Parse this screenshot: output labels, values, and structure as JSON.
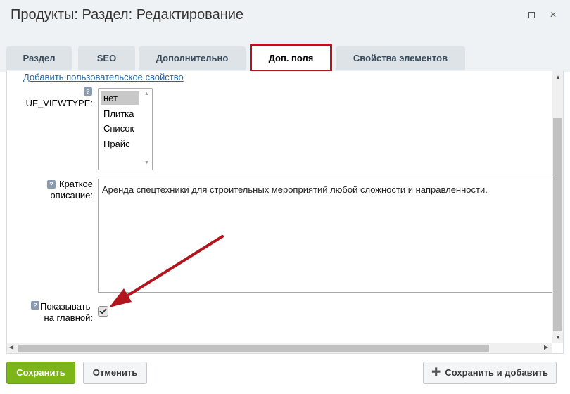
{
  "window": {
    "title": "Продукты: Раздел: Редактирование",
    "maximize_icon": "maximize-icon",
    "close_icon": "close-icon",
    "close_glyph": "×"
  },
  "tabs": [
    {
      "label": "Раздел",
      "active": false
    },
    {
      "label": "SEO",
      "active": false
    },
    {
      "label": "Дополнительно",
      "active": false
    },
    {
      "label": "Доп. поля",
      "active": true
    },
    {
      "label": "Свойства элементов",
      "active": false
    }
  ],
  "form": {
    "add_property_link": "Добавить пользовательское свойство",
    "help_glyph": "?",
    "viewtype": {
      "label": "UF_VIEWTYPE:",
      "options": [
        "нет",
        "Плитка",
        "Список",
        "Прайс"
      ],
      "selected": "нет"
    },
    "short_description": {
      "label_line1": "Краткое",
      "label_line2": "описание:",
      "value": "Аренда спецтехники для строительных мероприятий любой сложности и направленности."
    },
    "show_on_main": {
      "label_line1": "Показывать",
      "label_line2": "на главной:",
      "checked": true
    }
  },
  "buttons": {
    "save": "Сохранить",
    "cancel": "Отменить",
    "save_and_add": "Сохранить и добавить",
    "save_and_add_icon": "plus-icon"
  },
  "colors": {
    "highlight": "#b3151f",
    "save_button": "#7cb518",
    "link": "#2067b0"
  }
}
